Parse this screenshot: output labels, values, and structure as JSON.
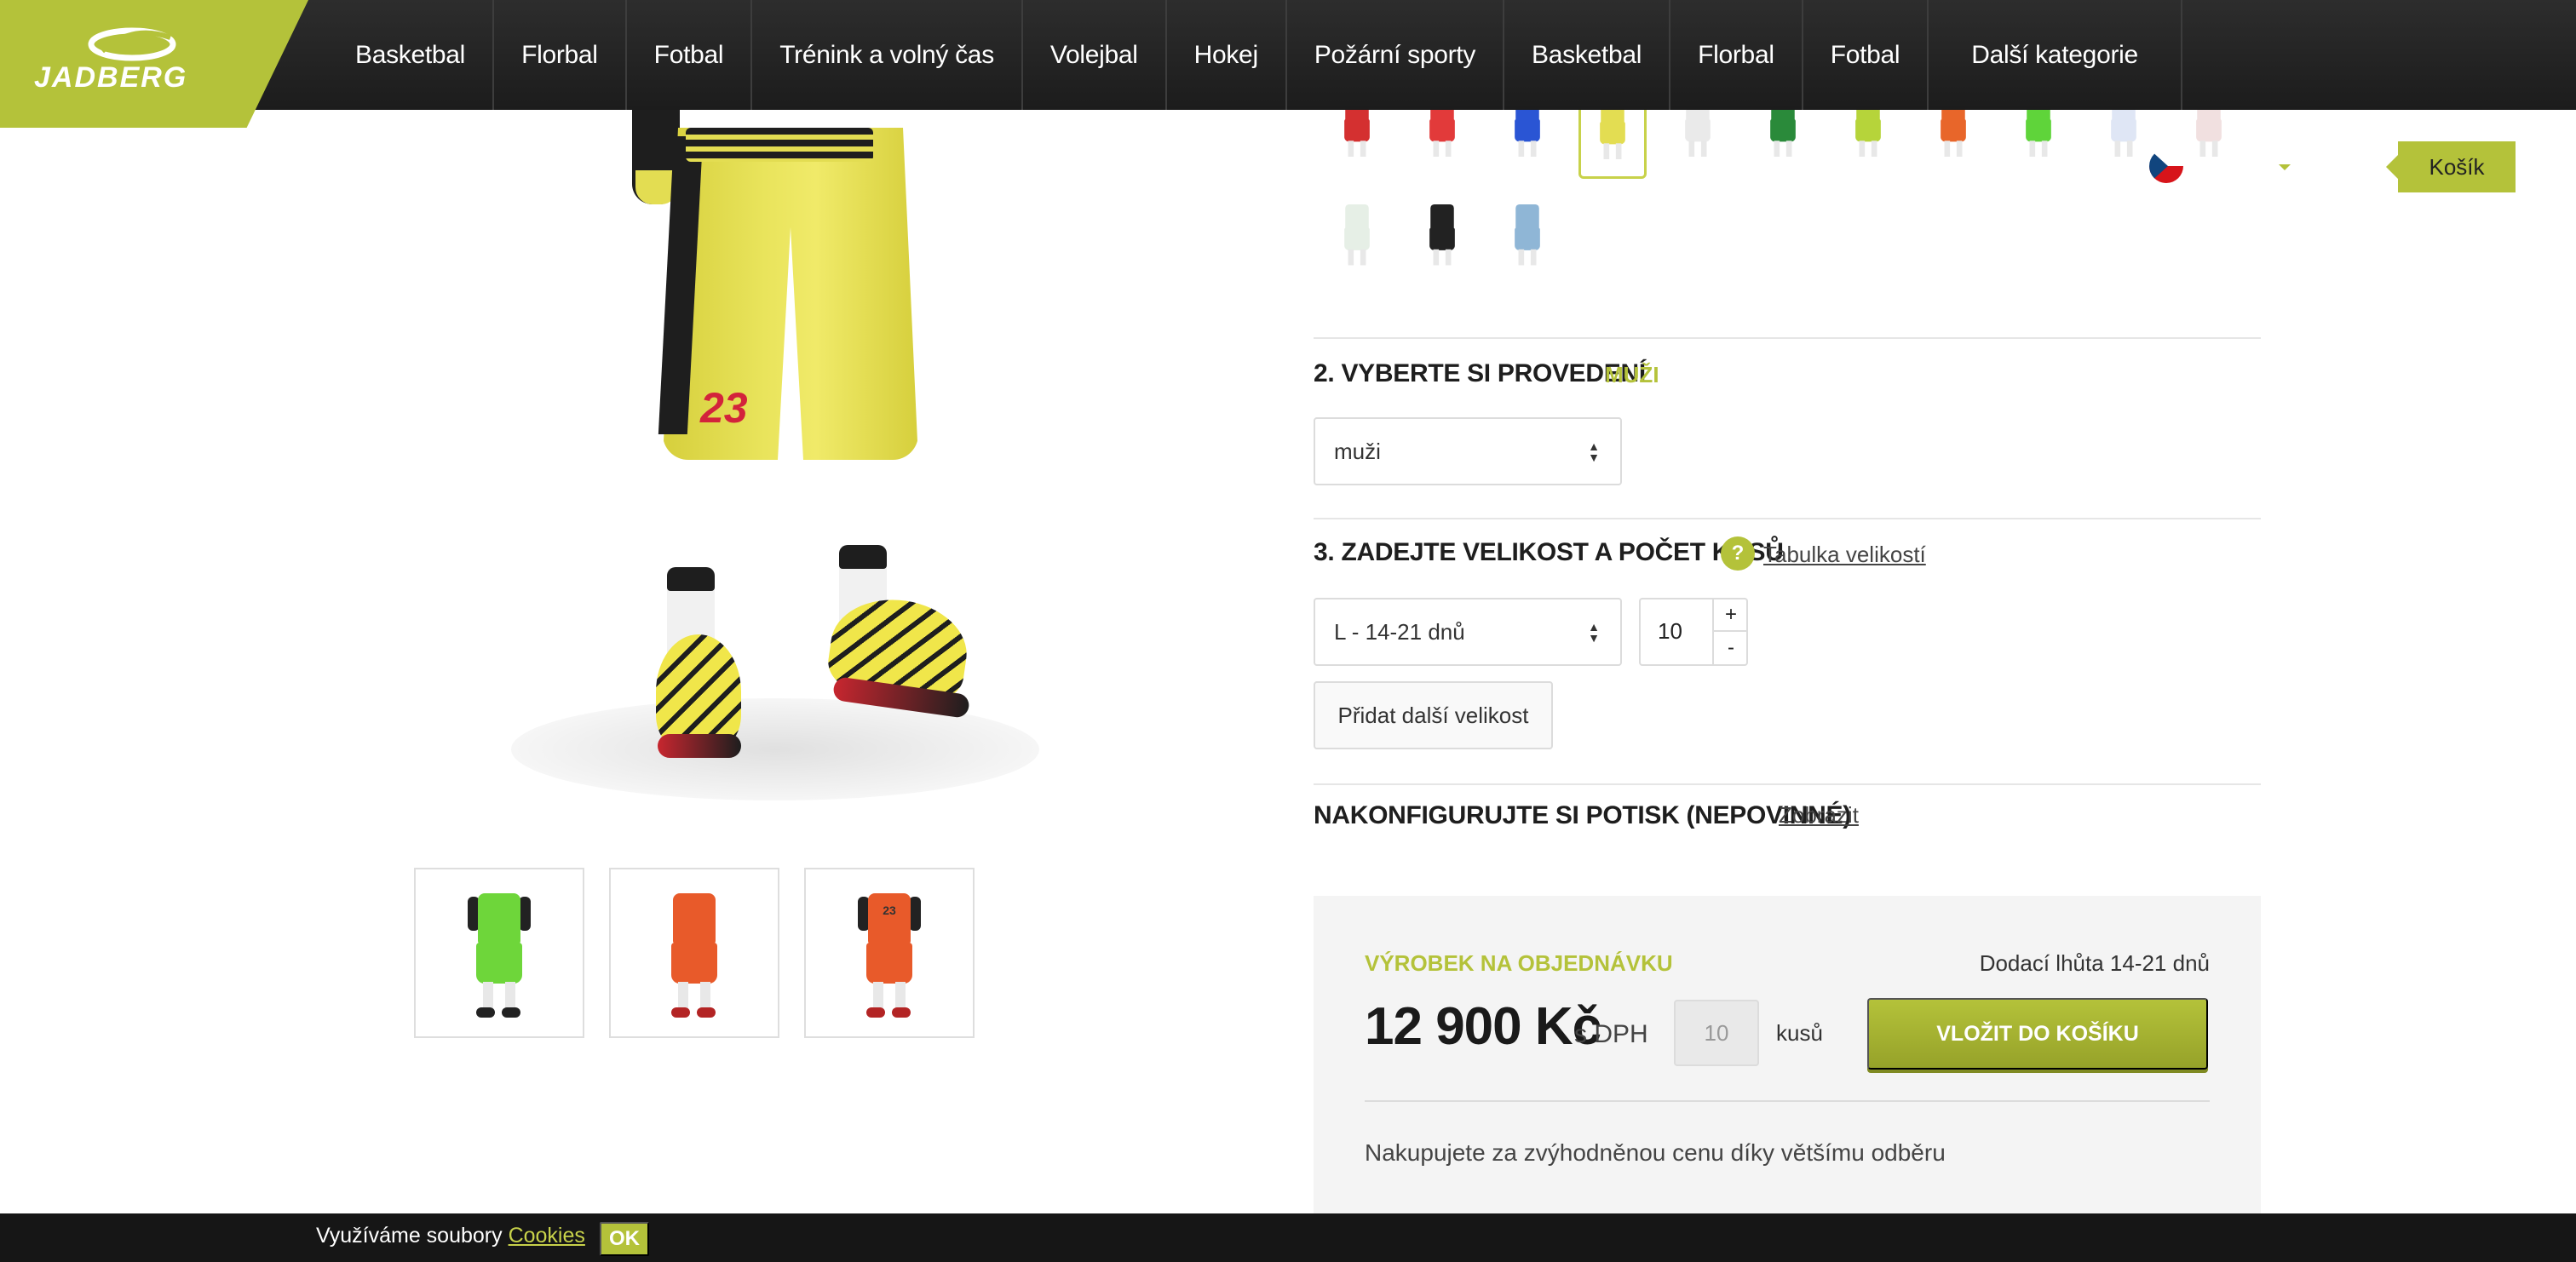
{
  "brand": {
    "logo_text": "JADBERG",
    "accent_color": "#b4c23a"
  },
  "nav": {
    "items": [
      {
        "label": "Basketbal"
      },
      {
        "label": "Florbal"
      },
      {
        "label": "Fotbal"
      },
      {
        "label": "Trénink a volný čas"
      },
      {
        "label": "Volejbal"
      },
      {
        "label": "Hokej"
      },
      {
        "label": "Požární sporty"
      },
      {
        "label": "Basketbal"
      },
      {
        "label": "Florbal"
      },
      {
        "label": "Fotbal"
      },
      {
        "label": "Další kategorie"
      }
    ]
  },
  "header": {
    "cart_label": "Košík",
    "language_icon": "czech-flag-icon"
  },
  "product_image": {
    "shorts_number": "23"
  },
  "thumbnails": [
    {
      "alt": "green-kit",
      "number": ""
    },
    {
      "alt": "orange-kit-front",
      "number": ""
    },
    {
      "alt": "orange-kit-back",
      "number": "23"
    }
  ],
  "step2": {
    "title": "2. VYBERTE SI PROVEDENÍ",
    "selected_tag": "MUŽI",
    "select_value": "muži"
  },
  "step3": {
    "title": "3. ZADEJTE VELIKOST A POČET KUSŮ",
    "help_icon_text": "?",
    "size_table_link": "Tabulka velikostí",
    "size_value": "L - 14-21 dnů",
    "quantity": "10",
    "plus": "+",
    "minus": "-",
    "add_size_button": "Přidat další velikost"
  },
  "print_config": {
    "title": "NAKONFIGURUJTE SI POTISK (NEPOVINNÉ)",
    "show_link": "Zobrazit"
  },
  "order": {
    "tag": "VÝROBEK NA OBJEDNÁVKU",
    "delivery": "Dodací lhůta 14-21 dnů",
    "price": "12 900 Kč",
    "vat": "s DPH",
    "quantity_placeholder": "10",
    "unit": "kusů",
    "add_to_cart": "VLOŽIT DO KOŠÍKU",
    "note": "Nakupujete za zvýhodněnou cenu díky většímu odběru"
  },
  "cookie": {
    "text": "Využíváme soubory ",
    "link": "Cookies",
    "ok": "OK"
  }
}
